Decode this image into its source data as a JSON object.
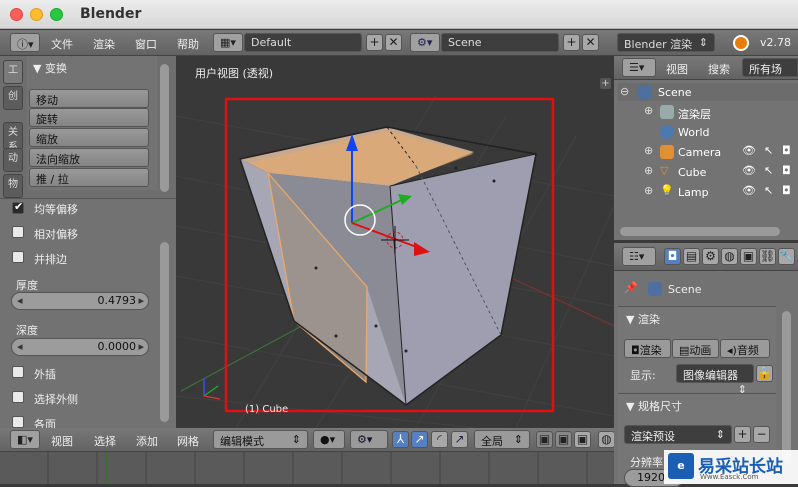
{
  "window": {
    "title": "Blender"
  },
  "menu": {
    "items": [
      "文件",
      "渲染",
      "窗口",
      "帮助"
    ],
    "layout": "Default",
    "scene": "Scene",
    "engine": "Blender 渲染",
    "version": "v2.78"
  },
  "toolshelf": {
    "tabs": [
      "工具",
      "创建",
      "关系",
      "动画",
      "物理"
    ],
    "section": "▼ 变换",
    "buttons": [
      "移动",
      "旋转",
      "缩放",
      "法向缩放",
      "推 / 拉"
    ],
    "options": {
      "even_offset": "均等偏移",
      "relative_offset": "相对偏移",
      "edge_rail": "并排边",
      "thickness_label": "厚度",
      "thickness": "0.4793",
      "depth_label": "深度",
      "depth": "0.0000",
      "outset": "外插",
      "select_outer": "选择外侧",
      "individual": "各面"
    }
  },
  "viewport": {
    "title": "用户视图 (透视)",
    "object_label": "(1) Cube"
  },
  "viewport_header": {
    "menus": [
      "视图",
      "选择",
      "添加",
      "网格"
    ],
    "mode": "编辑模式",
    "pivot_scope": "全局"
  },
  "outliner": {
    "menus": [
      "视图",
      "搜索",
      "所有场景"
    ],
    "scene": "Scene",
    "items": [
      "渲染层",
      "World",
      "Camera",
      "Cube",
      "Lamp"
    ]
  },
  "properties": {
    "scene": "Scene",
    "render_section": "▼ 渲染",
    "render_buttons": [
      "渲染",
      "动画",
      "音频"
    ],
    "display_label": "显示:",
    "display_value": "图像编辑器",
    "dimensions_section": "▼ 规格尺寸",
    "preset": "渲染预设",
    "resolution_label": "分辨率",
    "resolution_value": "1920"
  },
  "watermark": {
    "text": "易采站长站",
    "sub": "Www.Easck.Com"
  },
  "colors": {
    "selection_rect": "#e01010",
    "face_highlight": "#e8a96a",
    "x_axis": "#dd1111",
    "y_axis": "#22aa22",
    "z_axis": "#1144ee"
  }
}
